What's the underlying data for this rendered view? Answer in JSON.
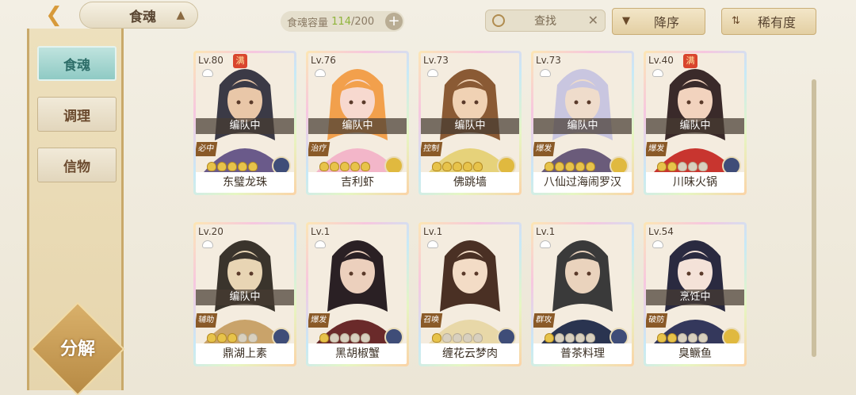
{
  "header": {
    "title": "食魂",
    "capacity_label": "食魂容量",
    "capacity_current": "114",
    "capacity_total": "/200",
    "search_label": "查找",
    "sort_order_label": "降序",
    "sort_key_label": "稀有度"
  },
  "sidebar": {
    "items": [
      {
        "label": "食魂",
        "active": true
      },
      {
        "label": "调理",
        "active": false
      },
      {
        "label": "信物",
        "active": false
      }
    ],
    "decompose_label": "分解"
  },
  "cards": [
    {
      "level": "Lv.80",
      "max": "满",
      "status": "编队中",
      "role": "必中",
      "stars": 5,
      "element": "blue",
      "name": "东璧龙珠",
      "portrait_colors": [
        "#3b3a46",
        "#e9c7a8",
        "#6a5a8a"
      ]
    },
    {
      "level": "Lv.76",
      "max": "",
      "status": "编队中",
      "role": "治疗",
      "stars": 5,
      "element": "gold",
      "name": "吉利虾",
      "portrait_colors": [
        "#f2a04c",
        "#f7d9cf",
        "#f3b6c9"
      ]
    },
    {
      "level": "Lv.73",
      "max": "",
      "status": "编队中",
      "role": "控制",
      "stars": 5,
      "element": "gold",
      "name": "佛跳墙",
      "portrait_colors": [
        "#8a5a34",
        "#f0d2b4",
        "#e6d27a"
      ]
    },
    {
      "level": "Lv.73",
      "max": "",
      "status": "编队中",
      "role": "爆发",
      "stars": 5,
      "element": "gold",
      "name": "八仙过海闹罗汉",
      "portrait_colors": [
        "#c9c6e0",
        "#efdccb",
        "#6a5b7a"
      ]
    },
    {
      "level": "Lv.40",
      "max": "满",
      "status": "编队中",
      "role": "爆发",
      "stars": 2,
      "element": "blue",
      "name": "川味火锅",
      "portrait_colors": [
        "#3a2a2a",
        "#f2d3be",
        "#c8352f"
      ]
    },
    {
      "level": "Lv.20",
      "max": "",
      "status": "编队中",
      "role": "辅助",
      "stars": 3,
      "element": "blue",
      "name": "鼎湖上素",
      "portrait_colors": [
        "#3a342c",
        "#e8d5b4",
        "#c9a36a"
      ]
    },
    {
      "level": "Lv.1",
      "max": "",
      "status": "",
      "role": "爆发",
      "stars": 1,
      "element": "blue",
      "name": "黑胡椒蟹",
      "portrait_colors": [
        "#2a2024",
        "#ecd0bd",
        "#6a2a2a"
      ]
    },
    {
      "level": "Lv.1",
      "max": "",
      "status": "",
      "role": "召唤",
      "stars": 1,
      "element": "blue",
      "name": "缠花云梦肉",
      "portrait_colors": [
        "#4a3024",
        "#f3dcc6",
        "#e8d8a8"
      ]
    },
    {
      "level": "Lv.1",
      "max": "",
      "status": "",
      "role": "群攻",
      "stars": 1,
      "element": "blue",
      "name": "普茶料理",
      "portrait_colors": [
        "#3a3a3a",
        "#ead3bd",
        "#2a3450"
      ]
    },
    {
      "level": "Lv.54",
      "max": "",
      "status": "烹饪中",
      "role": "破防",
      "stars": 2,
      "element": "gold",
      "name": "臭鳜鱼",
      "portrait_colors": [
        "#2a2a40",
        "#f4e2d8",
        "#34385c"
      ]
    }
  ],
  "icons": {
    "back": "back-arrow-icon",
    "crown": "crown-icon",
    "plus": "plus-icon",
    "search": "search-icon",
    "clear": "close-icon",
    "sort_order": "sort-triangle-icon",
    "sort_key": "sort-swap-icon",
    "lock": "lock-icon",
    "star": "star-icon",
    "element": "element-icon"
  }
}
